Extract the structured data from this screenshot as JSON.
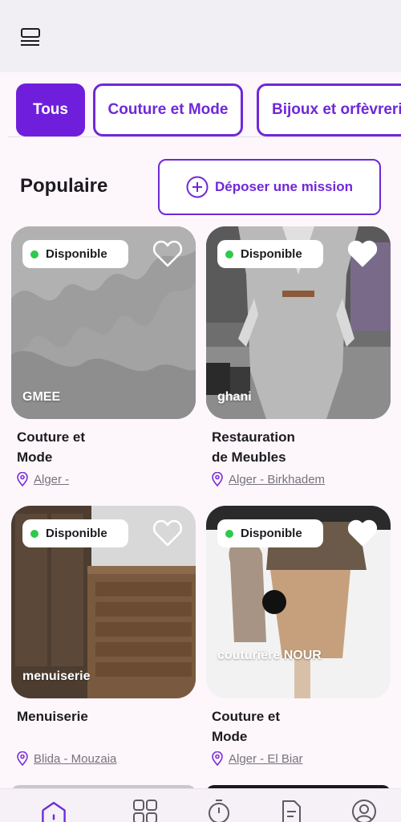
{
  "header": {
    "menu_icon": "menu-list-icon"
  },
  "filters": {
    "chips": [
      {
        "label": "Tous",
        "active": true
      },
      {
        "label": "Couture et Mode",
        "active": false
      },
      {
        "label": "Bijoux et orfèvreri",
        "active": false
      }
    ]
  },
  "section": {
    "title": "Populaire",
    "mission_button_label": "Déposer une mission",
    "mission_button_icon": "add-circle-icon"
  },
  "cards": [
    {
      "status": "Disponible",
      "owner": "GMEE",
      "title_line1": "Couture et",
      "title_line2": "Mode",
      "location": "Alger -",
      "favorite_icon": "heart-outline-icon"
    },
    {
      "status": "Disponible",
      "owner": "ghani",
      "title_line1": "Restauration",
      "title_line2": "de Meubles",
      "location": "Alger - Birkhadem",
      "favorite_icon": "heart-filled-icon"
    },
    {
      "status": "Disponible",
      "owner": "menuiserie",
      "title_line1": "Menuiserie",
      "title_line2": "",
      "location": "Blida - Mouzaia",
      "favorite_icon": "heart-outline-icon"
    },
    {
      "status": "Disponible",
      "owner": "couturière NOUR",
      "title_line1": "Couture et",
      "title_line2": "Mode",
      "location": "Alger - El Biar",
      "favorite_icon": "heart-filled-icon"
    }
  ],
  "bottom_nav": [
    {
      "icon": "home-icon",
      "active": true
    },
    {
      "icon": "grid-icon",
      "active": false
    },
    {
      "icon": "timer-icon",
      "active": false
    },
    {
      "icon": "document-icon",
      "active": false
    },
    {
      "icon": "profile-icon",
      "active": false
    }
  ],
  "colors": {
    "accent": "#6f28d9",
    "available": "#2ec94e",
    "background": "#fdf7fc"
  }
}
